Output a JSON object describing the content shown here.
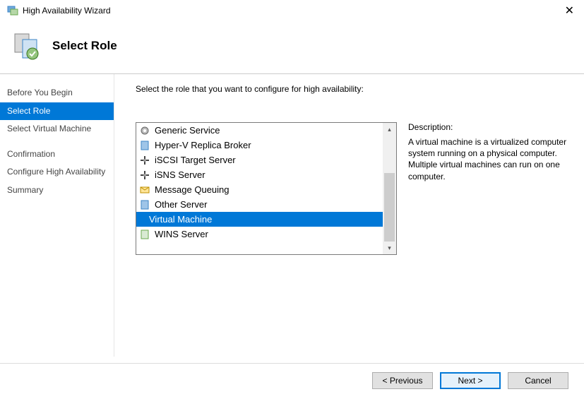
{
  "window": {
    "title": "High Availability Wizard"
  },
  "header": {
    "title": "Select Role"
  },
  "sidebar": {
    "steps": [
      {
        "label": "Before You Begin"
      },
      {
        "label": "Select Role"
      },
      {
        "label": "Select Virtual Machine"
      },
      {
        "label": "Confirmation"
      },
      {
        "label": "Configure High Availability"
      },
      {
        "label": "Summary"
      }
    ]
  },
  "content": {
    "instruction": "Select the role that you want to configure for high availability:",
    "roles": [
      {
        "label": "Generic Service",
        "icon": "gear-icon"
      },
      {
        "label": "Hyper-V Replica Broker",
        "icon": "server-icon"
      },
      {
        "label": "iSCSI Target Server",
        "icon": "iscsi-icon"
      },
      {
        "label": "iSNS Server",
        "icon": "isns-icon"
      },
      {
        "label": "Message Queuing",
        "icon": "message-icon"
      },
      {
        "label": "Other Server",
        "icon": "server-icon"
      },
      {
        "label": "Virtual Machine",
        "icon": "vm-icon"
      },
      {
        "label": "WINS Server",
        "icon": "wins-icon"
      }
    ],
    "selected_role_index": 6,
    "description_label": "Description:",
    "description_text": "A virtual machine is a virtualized computer system running on a physical computer. Multiple virtual machines can run on one computer."
  },
  "buttons": {
    "previous": "< Previous",
    "next": "Next >",
    "cancel": "Cancel"
  }
}
